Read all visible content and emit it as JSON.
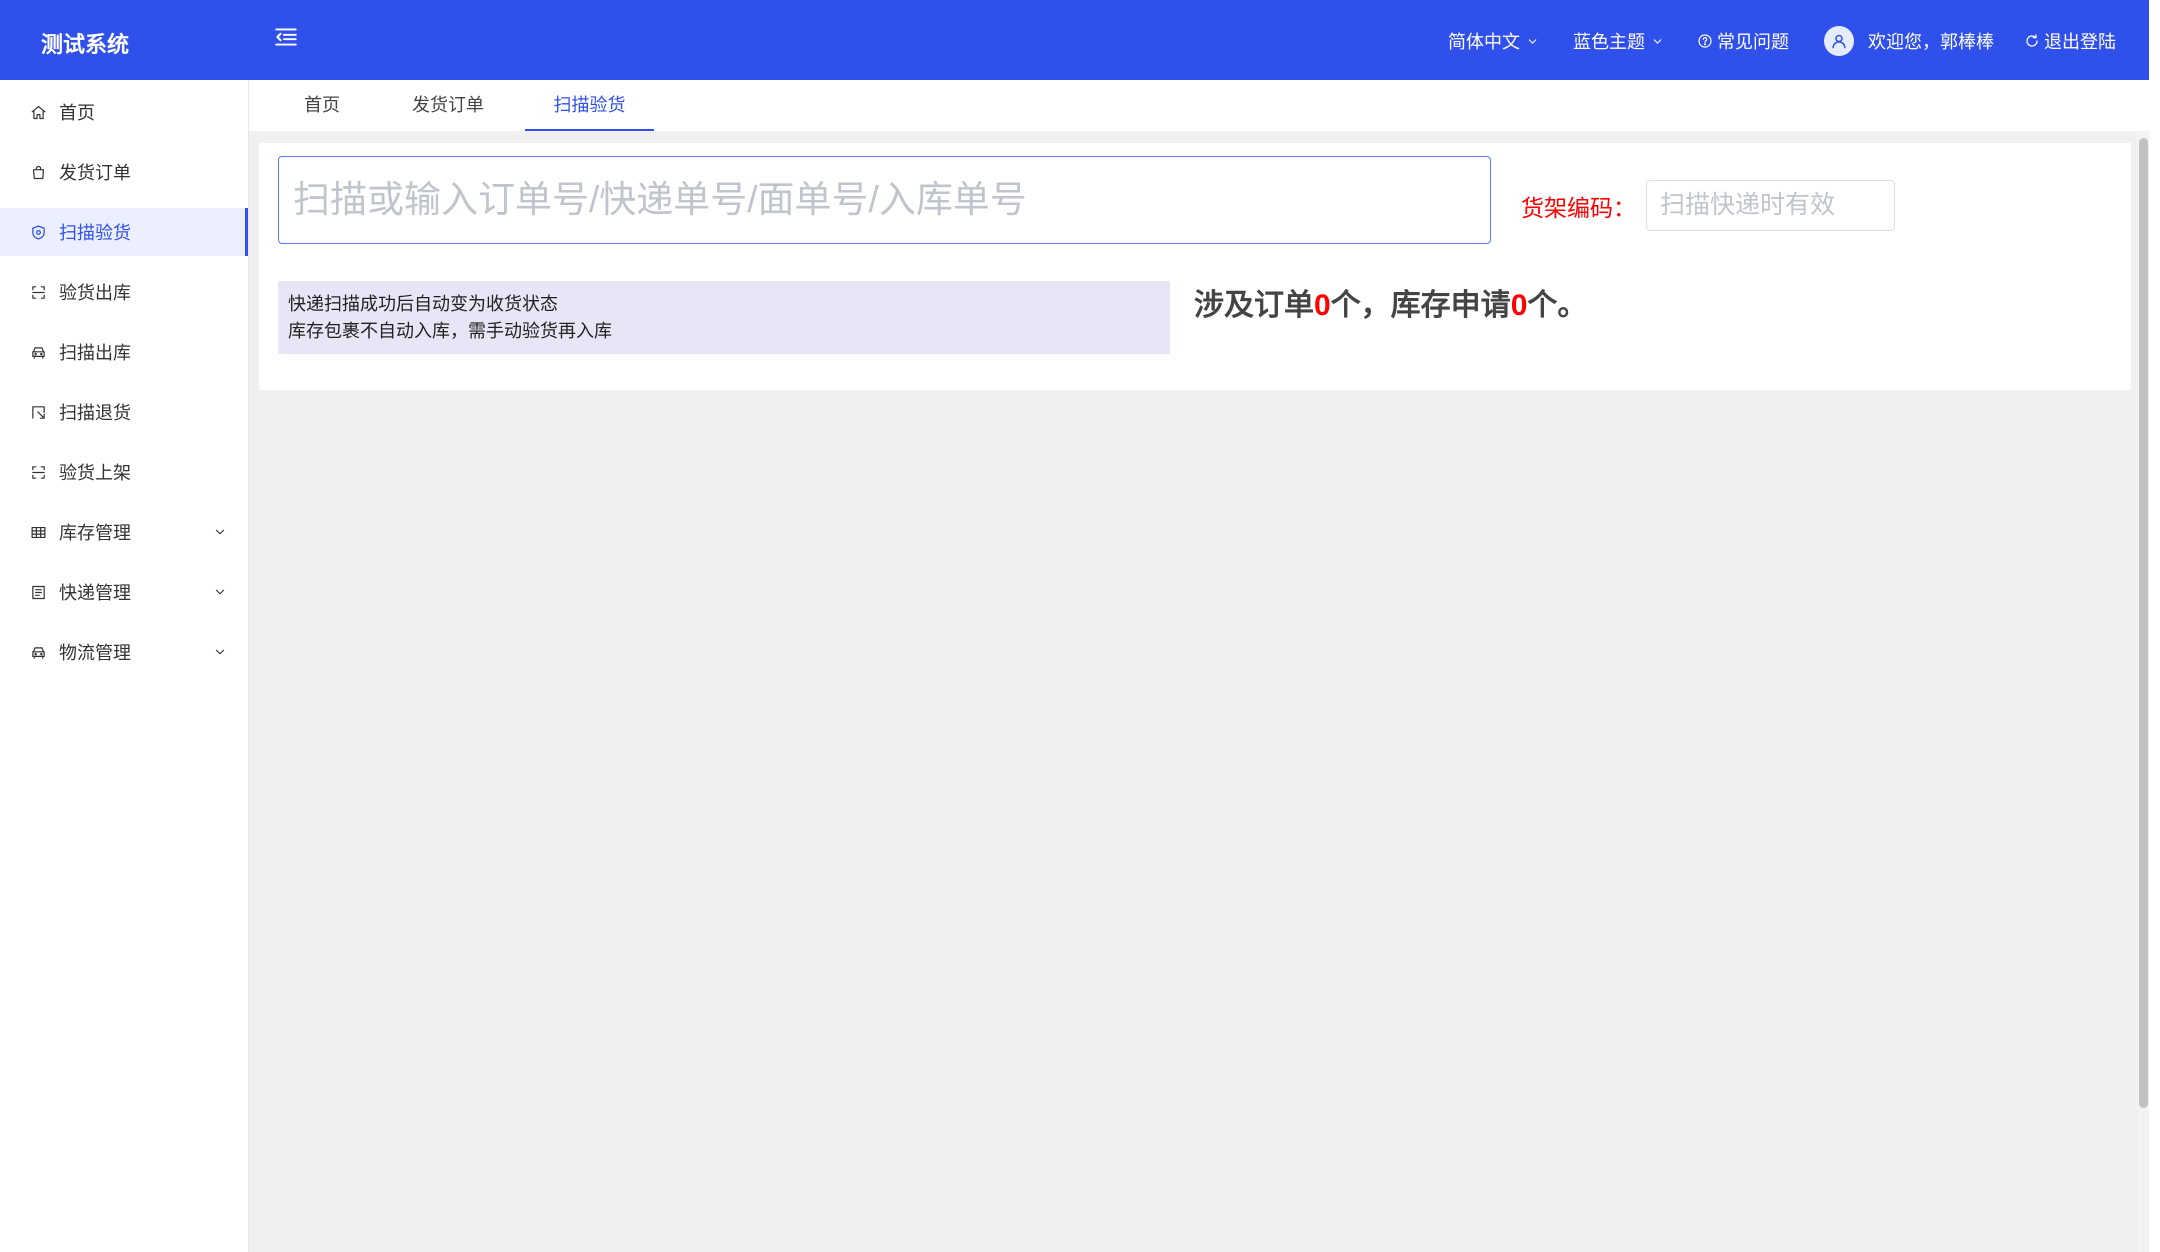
{
  "colors": {
    "primary": "#3050eb",
    "danger": "#ff0000",
    "active_bg": "#ecf0fe",
    "notice_bg": "#e6e6f6"
  },
  "app": {
    "title": "测试系统"
  },
  "header": {
    "menu_toggle_icon": "menu-fold-icon",
    "language": {
      "label": "简体中文",
      "icon": "chevron-down-icon"
    },
    "theme": {
      "label": "蓝色主题",
      "icon": "chevron-down-icon"
    },
    "faq": {
      "label": "常见问题",
      "icon": "question-circle-icon"
    },
    "user": {
      "greeting": "欢迎您，郭棒棒",
      "icon": "avatar-icon"
    },
    "logout": {
      "label": "退出登陆",
      "icon": "logout-icon"
    }
  },
  "sidebar": {
    "items": [
      {
        "label": "首页",
        "icon": "home-icon",
        "active": false
      },
      {
        "label": "发货订单",
        "icon": "shopping-bag-icon",
        "active": false
      },
      {
        "label": "扫描验货",
        "icon": "shield-icon",
        "active": true
      },
      {
        "label": "验货出库",
        "icon": "scan-icon",
        "active": false
      },
      {
        "label": "扫描出库",
        "icon": "car-icon",
        "active": false
      },
      {
        "label": "扫描退货",
        "icon": "return-icon",
        "active": false
      },
      {
        "label": "验货上架",
        "icon": "scan-icon",
        "active": false
      },
      {
        "label": "库存管理",
        "icon": "table-icon",
        "active": false,
        "expandable": true
      },
      {
        "label": "快递管理",
        "icon": "list-icon",
        "active": false,
        "expandable": true
      },
      {
        "label": "物流管理",
        "icon": "car-icon",
        "active": false,
        "expandable": true
      }
    ]
  },
  "tabs": [
    {
      "label": "首页",
      "active": false
    },
    {
      "label": "发货订单",
      "active": false
    },
    {
      "label": "扫描验货",
      "active": true
    }
  ],
  "scan": {
    "value": "",
    "placeholder": "扫描或输入订单号/快递单号/面单号/入库单号"
  },
  "shelf": {
    "label": "货架编码：",
    "value": "",
    "placeholder": "扫描快递时有效"
  },
  "notice": {
    "lines": [
      "快递扫描成功后自动变为收货状态",
      "库存包裹不自动入库，需手动验货再入库"
    ]
  },
  "summary": {
    "text_1": "涉及订单",
    "order_count": "0",
    "text_2": "个，库存申请",
    "request_count": "0",
    "text_3": "个。"
  }
}
